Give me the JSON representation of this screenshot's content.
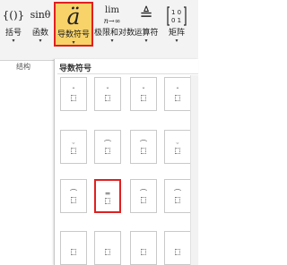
{
  "ribbon": {
    "buttons": [
      {
        "label": "括号",
        "icon": "{()}"
      },
      {
        "label": "函数",
        "icon": "sinθ"
      },
      {
        "label": "导数符号",
        "icon": "ä"
      },
      {
        "label": "极限和对数",
        "icon_top": "lim",
        "icon_bottom": "n→∞"
      },
      {
        "label": "运算符",
        "icon": "≜"
      },
      {
        "label": "矩阵",
        "icon": "[1 0; 0 1]"
      }
    ],
    "group_label": "结构",
    "dropdown_arrow": "▾"
  },
  "gallery": {
    "title": "导数符号",
    "rows": [
      [
        "ˆ",
        "ˇ",
        "ˇ",
        "ˆ"
      ],
      [
        "ᵕ",
        "⌒",
        "⌒",
        "ᵕ"
      ],
      [
        "⌒",
        "═",
        "⌒",
        "⌒"
      ],
      [
        "",
        "",
        "",
        ""
      ]
    ],
    "selected": {
      "row": 2,
      "col": 1
    }
  },
  "colors": {
    "highlight": "#f7d36a",
    "selection_border": "#e02020"
  }
}
